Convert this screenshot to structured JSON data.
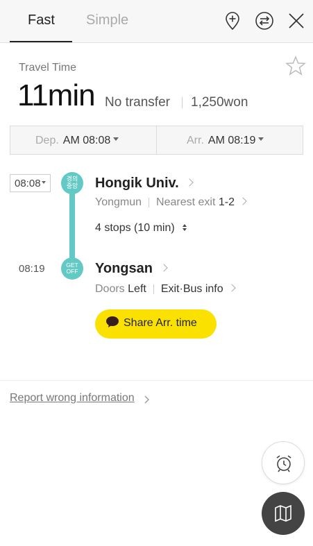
{
  "tabs": {
    "fast": "Fast",
    "simple": "Simple"
  },
  "icons": {
    "add_place": "map-pin-plus-icon",
    "swap": "swap-icon",
    "close": "close-icon",
    "favorite": "star-icon",
    "alarm": "alarm-clock-icon",
    "map": "map-icon",
    "chat": "speech-bubble-icon"
  },
  "summary": {
    "label": "Travel Time",
    "duration": "11min",
    "transfer": "No transfer",
    "fare": "1,250won"
  },
  "times": {
    "dep_label": "Dep.",
    "dep_value": "AM 08:08",
    "arr_label": "Arr.",
    "arr_value": "AM 08:19"
  },
  "route": {
    "dep_time": "08:08",
    "line_badge_top": "경의",
    "line_badge_bottom": "중앙",
    "line_color": "#63c9c4",
    "start_station": "Hongik Univ.",
    "direction": "Yongmun",
    "exit_label": "Nearest exit",
    "exit_value": "1-2",
    "stops": "4 stops (10 min)",
    "getoff_top": "GET",
    "getoff_bottom": "OFF",
    "arr_time": "08:19",
    "end_station": "Yongsan",
    "doors_label": "Doors",
    "doors_value": "Left",
    "exit_bus": "Exit·Bus info"
  },
  "share": {
    "label": "Share Arr. time",
    "color": "#fae100"
  },
  "report": {
    "label": "Report wrong information"
  }
}
